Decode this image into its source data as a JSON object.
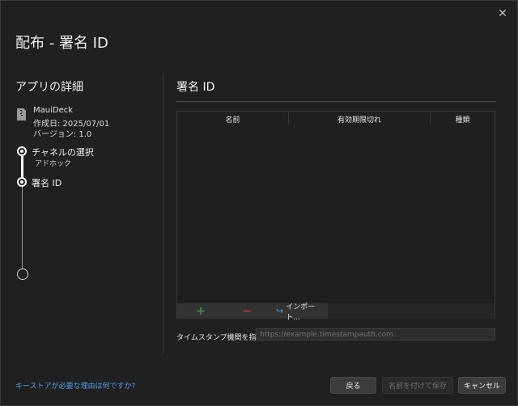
{
  "window": {
    "title": "配布 - 署名 ID",
    "close_glyph": "✕"
  },
  "left": {
    "heading": "アプリの詳細",
    "app": {
      "icon": "document-zip-icon",
      "name": "MauiDeck",
      "created": "作成日: 2025/07/01",
      "version": "バージョン: 1.0"
    },
    "steps": [
      {
        "label": "チャネルの選択",
        "sub": "アドホック",
        "state": "done"
      },
      {
        "label": "署名 ID",
        "sub": "",
        "state": "current"
      },
      {
        "label": "",
        "sub": "",
        "state": "pending"
      }
    ]
  },
  "right": {
    "heading": "署名 ID",
    "table": {
      "columns": [
        "名前",
        "有効期限切れ",
        "種類"
      ],
      "rows": []
    },
    "toolbar": {
      "add_glyph": "+",
      "remove_glyph": "−",
      "import_label": "インポート..."
    },
    "timestamp": {
      "label": "タイムスタンプ機関を指定",
      "placeholder": "https://example.timestampauth.com",
      "value": ""
    }
  },
  "footer": {
    "help_link": "キーストアが必要な理由は何ですか?",
    "back_label": "戻る",
    "save_label": "名前を付けて保存",
    "cancel_label": "キャンセル"
  },
  "colors": {
    "background": "#202020",
    "accent_link": "#4ea0e8",
    "add_green": "#3fa34d",
    "remove_red": "#d9443f"
  }
}
